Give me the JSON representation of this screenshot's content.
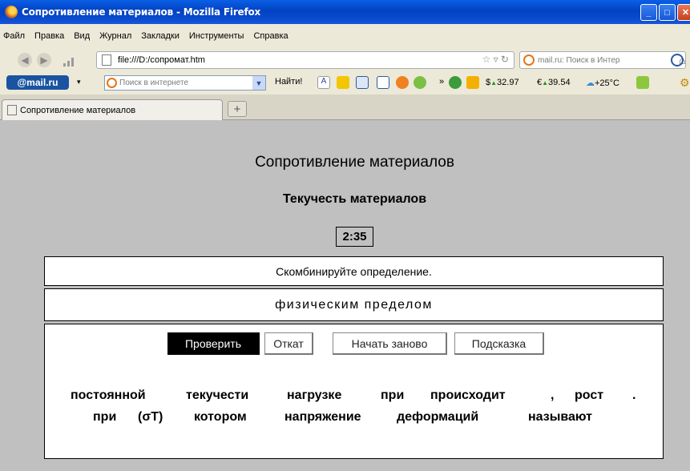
{
  "window": {
    "title": "Сопротивление материалов - Mozilla Firefox"
  },
  "menu": [
    "Файл",
    "Правка",
    "Вид",
    "Журнал",
    "Закладки",
    "Инструменты",
    "Справка"
  ],
  "navbar": {
    "url": "file:///D:/сопромат.htm",
    "search_placeholder": "mail.ru: Поиск в Интер"
  },
  "mailbar": {
    "logo": "@mail.ru",
    "search_placeholder": "Поиск в интернете",
    "find_label": "Найти!",
    "usd": "32.97",
    "eur": "39.54",
    "weather": "+25°C"
  },
  "tabs": [
    {
      "label": "Сопротивление материалов"
    }
  ],
  "page": {
    "title": "Сопротивление материалов",
    "subtitle": "Текучесть материалов",
    "timer": "2:35",
    "instruction": "Скомбинируйте определение.",
    "answer": "физическим пределом",
    "buttons": {
      "check": "Проверить",
      "undo": "Откат",
      "restart": "Начать заново",
      "hint": "Подсказка"
    },
    "words_row1": [
      "постоянной",
      "текучести",
      "нагрузке",
      "при",
      "происходит",
      ",",
      "рост",
      "."
    ],
    "words_row2": [
      "при",
      "(σТ)",
      "котором",
      "напряжение",
      "деформаций",
      "называют"
    ]
  }
}
